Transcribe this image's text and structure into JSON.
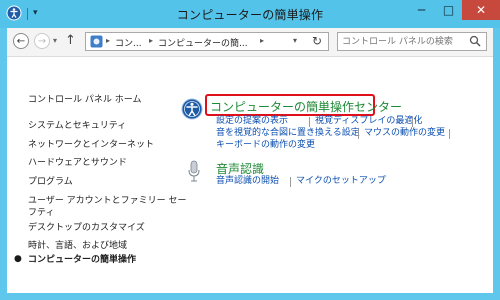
{
  "window": {
    "title": "コンピューターの簡単操作"
  },
  "controls": {
    "minimize": "─",
    "maximize": "□",
    "close": "✕"
  },
  "address": {
    "crumbs": [
      "コン...",
      "コンピューターの簡...",
      ""
    ],
    "search_placeholder": "コントロール パネルの検索"
  },
  "sidebar": {
    "home": "コントロール パネル ホーム",
    "items": [
      "システムとセキュリティ",
      "ネットワークとインターネット",
      "ハードウェアとサウンド",
      "プログラム",
      "ユーザー アカウントとファミリー セー",
      "フティ",
      "デスクトップのカスタマイズ",
      "時計、言語、および地域",
      "コンピューターの簡単操作"
    ]
  },
  "main": {
    "ease_center": {
      "title": "コンピューターの簡単操作センター",
      "links": [
        "設定の提案の表示",
        "視覚ディスプレイの最適化",
        "音を視覚的な合図に置き換える設定",
        "マウスの動作の変更",
        "キーボードの動作の変更"
      ]
    },
    "speech": {
      "title": "音声認識",
      "links": [
        "音声認識の開始",
        "マイクのセットアップ"
      ]
    }
  },
  "colors": {
    "frame": "#5fc7ec",
    "close_button": "#c7483c",
    "category_title": "#1f8a36",
    "link": "#0c4fb0",
    "highlight_box": "#e0101a"
  },
  "icons": {
    "app": "ease-of-access-icon",
    "back": "back-arrow-icon",
    "forward": "forward-arrow-icon",
    "up": "up-arrow-icon",
    "refresh": "refresh-icon",
    "search": "search-icon",
    "ease_center": "ease-of-access-icon",
    "speech": "microphone-icon"
  }
}
